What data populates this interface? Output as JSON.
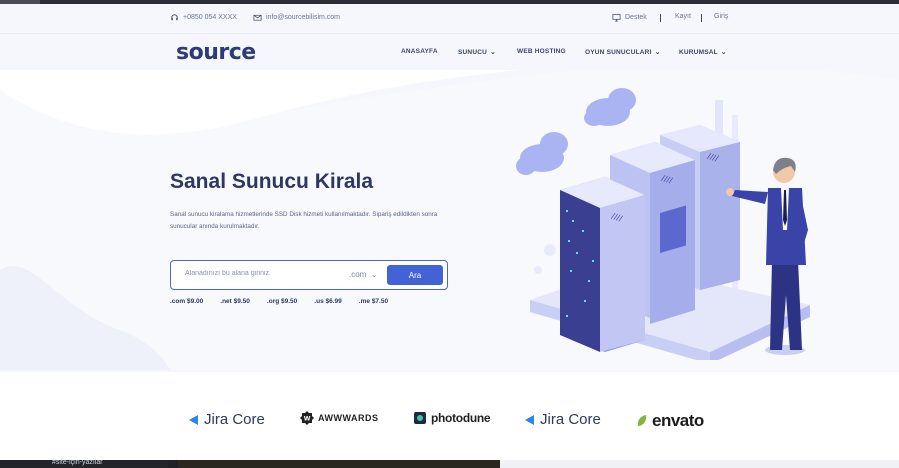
{
  "topbar": {
    "phone": "+0850 054 XXXX",
    "email": "info@sourcebilisim.com",
    "support": "Destek",
    "register": "Kayıt",
    "login": "Giriş"
  },
  "brand": {
    "logo": "source"
  },
  "nav": {
    "items": [
      {
        "label": "ANASAYFA",
        "dropdown": false
      },
      {
        "label": "SUNUCU",
        "dropdown": true
      },
      {
        "label": "WEB HOSTING",
        "dropdown": false
      },
      {
        "label": "OYUN SUNUCULARI",
        "dropdown": true
      },
      {
        "label": "KURUMSAL",
        "dropdown": true
      }
    ]
  },
  "hero": {
    "title": "Sanal Sunucu Kirala",
    "description": "Sanal sunucu kiralama hizmetlerinde SSD Disk hizmeti kullanılmaktadır. Sipariş edildikten sonra sunucular anında kurulmaktadır."
  },
  "search": {
    "placeholder": "Alanadınızı bu alana giriniz.",
    "tld": ".com",
    "button": "Ara"
  },
  "prices": [
    {
      "tld": ".com",
      "price": "$9.00"
    },
    {
      "tld": ".net",
      "price": "$9.50"
    },
    {
      "tld": ".org",
      "price": "$9.50"
    },
    {
      "tld": ".us",
      "price": "$6.99"
    },
    {
      "tld": ".me",
      "price": "$7.50"
    }
  ],
  "partners": [
    "Jira Core",
    "AWWWARDS",
    "photodune",
    "Jira Core",
    "envato"
  ],
  "taskbar": {
    "label": "#site-için-yazılar"
  },
  "colors": {
    "brand": "#2f3a78",
    "accent": "#4262d6",
    "heading": "#2e3761",
    "illustration": "#6f7ce6"
  }
}
